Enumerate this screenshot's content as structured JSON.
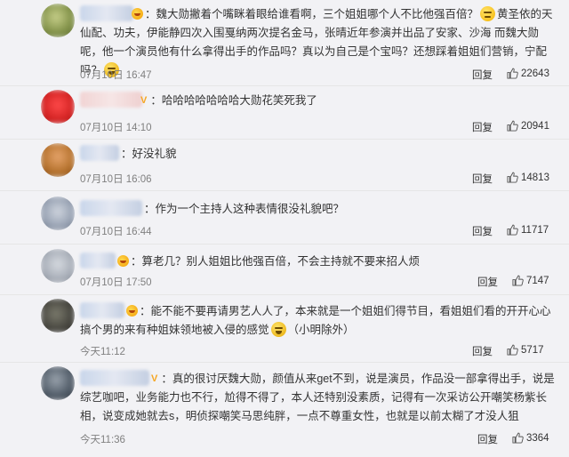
{
  "comments": [
    {
      "text": "魏大勋撇着个嘴眯着眼给谁看啊，三个姐姐哪个人不比他强百倍？",
      "text_tail": "黄圣依的天仙配、功夫，伊能静四次入围戛纳两次提名金马，张晴近年参演并出品了安家、沙海 而魏大勋呢，他一个演员他有什么拿得出手的作品吗？真以为自己是个宝吗？还想踩着姐姐们营销，宁配吗？",
      "time": "07月10日 16:47",
      "reply": "回复",
      "likes": "22643",
      "avatar_color": "#8a9b5a"
    },
    {
      "text": "哈哈哈哈哈哈哈大勋花笑死我了",
      "time": "07月10日 14:10",
      "reply": "回复",
      "likes": "20941",
      "avatar_color": "#d83030"
    },
    {
      "text": "好没礼貌",
      "time": "07月10日 16:06",
      "reply": "回复",
      "likes": "14813",
      "avatar_color": "#b5722d"
    },
    {
      "text": "作为一个主持人这种表情很没礼貌吧？",
      "time": "07月10日 16:44",
      "reply": "回复",
      "likes": "11717",
      "avatar_color": "#8d98aa"
    },
    {
      "text": "算老几？别人姐姐比他强百倍，不会主持就不要来招人烦",
      "time": "07月10日 17:50",
      "reply": "回复",
      "likes": "7147",
      "avatar_color": "#9aa1ad"
    },
    {
      "text": "能不能不要再请男艺人人了，本来就是一个姐姐们得节目，看姐姐们看的开开心心 搞个男的来有种姐妹领地被入侵的感觉",
      "text_tail": "（小明除外）",
      "time": "今天11:12",
      "reply": "回复",
      "likes": "5717",
      "avatar_color": "#4b4a43"
    },
    {
      "text": "真的很讨厌魏大勋，颜值从来get不到，说是演员，作品没一部拿得出手，说是综艺咖吧，业务能力也不行，尬得不得了，本人还特别没素质，记得有一次采访公开嘲笑杨紫长相，说变成她就去s，明侦探嘲笑马思纯胖，一点不尊重女性，也就是以前太糊了才没人狙",
      "time": "今天11:36",
      "reply": "回复",
      "likes": "3364",
      "avatar_color": "#55606c"
    }
  ]
}
